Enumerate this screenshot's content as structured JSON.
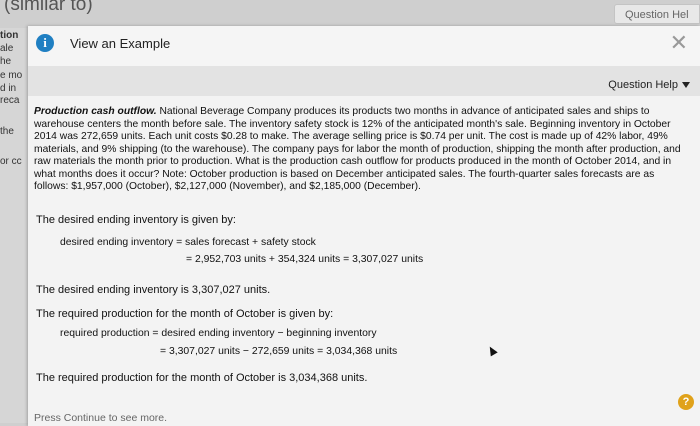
{
  "background": {
    "title": "(similar to)",
    "question_help_tab": "Question Hel",
    "left_fragments": [
      "tion",
      "ale",
      "he",
      "e mo",
      "d in",
      "reca",
      "the",
      "or cc"
    ]
  },
  "modal": {
    "info_icon": "info-icon",
    "title": "View an Example",
    "close_icon": "close-icon",
    "question_help": "Question Help",
    "problem_title": "Production cash outflow.",
    "problem_body": " National Beverage Company produces its products two months in advance of anticipated sales and ships to warehouse centers the month before sale. The inventory safety stock is 12% of the anticipated month's sale. Beginning inventory in October 2014 was 272,659 units. Each unit costs $0.28 to make. The average selling price is $0.74 per unit. The cost is made up of 42% labor, 49% materials, and 9% shipping (to the warehouse). The company pays for labor the month of production, shipping the month after production, and raw materials the month prior to production. What is the production cash outflow for products produced in the month of October 2014, and in what months does it occur? Note: October production is based on December anticipated sales. The fourth-quarter sales forecasts are as follows: $1,957,000 (October), $2,127,000 (November), and $2,185,000 (December).",
    "step1_prompt": "The desired ending inventory is given by:",
    "step1_formula": "desired ending inventory = sales forecast + safety stock",
    "step1_result": "= 2,952,703 units + 354,324 units = 3,307,027 units",
    "step1_conclusion": "The desired ending inventory is 3,307,027 units.",
    "step2_prompt": "The required production for the month of October is given by:",
    "step2_formula": "required production = desired ending inventory − beginning inventory",
    "step2_result": "= 3,307,027 units − 272,659 units = 3,034,368 units",
    "step2_conclusion": "The required production for the month of October is 3,034,368 units.",
    "continue_text": "Press Continue to see more.",
    "help_badge": "?"
  }
}
